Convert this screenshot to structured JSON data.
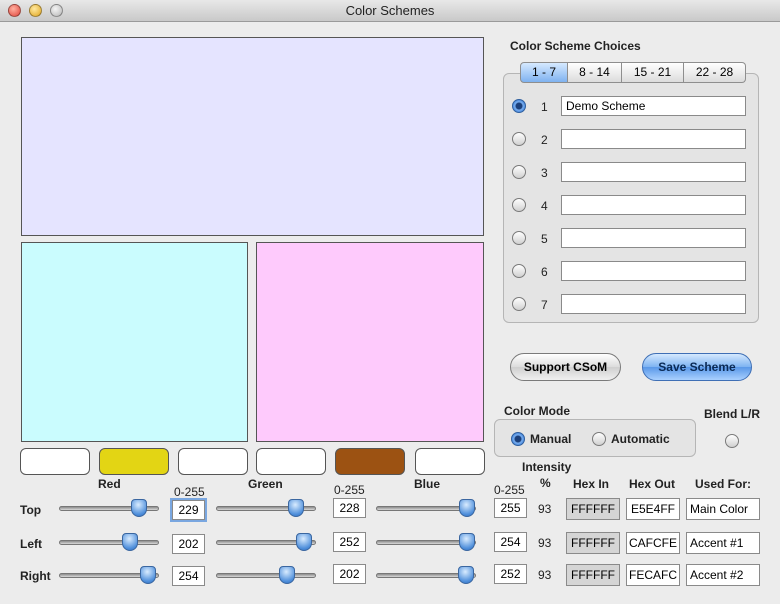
{
  "window": {
    "title": "Color Schemes"
  },
  "preview": {
    "main_color": "#E5E4FF",
    "left_color": "#CAFCFE",
    "right_color": "#FECAFC"
  },
  "swatch_colors": [
    "#FFFFFF",
    "#E3D514",
    "#FFFFFF",
    "#FFFFFF",
    "#9C5212",
    "#FFFFFF"
  ],
  "labels": {
    "red": "Red",
    "green": "Green",
    "blue": "Blue",
    "range": "0-255",
    "intensity": "Intensity",
    "percent": "%",
    "hex_in": "Hex  In",
    "hex_out": "Hex  Out",
    "used_for": "Used For:"
  },
  "rows": [
    {
      "label": "Top",
      "red": "229",
      "green": "228",
      "blue": "255",
      "red_level": 0.8,
      "green_level": 0.8,
      "blue_level": 0.91,
      "intensity": "93",
      "hex_in": "FFFFFF",
      "hex_out": "E5E4FF",
      "used_for": "Main Color"
    },
    {
      "label": "Left",
      "red": "202",
      "green": "252",
      "blue": "254",
      "red_level": 0.71,
      "green_level": 0.88,
      "blue_level": 0.91,
      "intensity": "93",
      "hex_in": "FFFFFF",
      "hex_out": "CAFCFE",
      "used_for": "Accent #1"
    },
    {
      "label": "Right",
      "red": "254",
      "green": "202",
      "blue": "252",
      "red_level": 0.89,
      "green_level": 0.71,
      "blue_level": 0.9,
      "intensity": "93",
      "hex_in": "FFFFFF",
      "hex_out": "FECAFC",
      "used_for": "Accent #2"
    }
  ],
  "scheme_choices": {
    "title": "Color Scheme Choices",
    "tabs": [
      "1 - 7",
      "8 - 14",
      "15 - 21",
      "22 - 28"
    ],
    "active_tab": 0,
    "items": [
      {
        "num": "1",
        "name": "Demo Scheme",
        "selected": true
      },
      {
        "num": "2",
        "name": "",
        "selected": false
      },
      {
        "num": "3",
        "name": "",
        "selected": false
      },
      {
        "num": "4",
        "name": "",
        "selected": false
      },
      {
        "num": "5",
        "name": "",
        "selected": false
      },
      {
        "num": "6",
        "name": "",
        "selected": false
      },
      {
        "num": "7",
        "name": "",
        "selected": false
      }
    ]
  },
  "buttons": {
    "support": "Support CSoM",
    "save": "Save Scheme"
  },
  "color_mode": {
    "title": "Color Mode",
    "manual": "Manual",
    "automatic": "Automatic",
    "selected": "Manual"
  },
  "blend": {
    "label": "Blend L/R"
  }
}
